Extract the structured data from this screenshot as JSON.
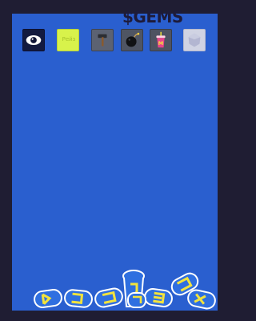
{
  "title": "$GEMS",
  "toolbar": {
    "tools": [
      {
        "name": "eye-icon",
        "color": "#131a3f"
      },
      {
        "name": "brush-icon",
        "color": "#d8f24b",
        "label": "Рейз"
      },
      {
        "name": "hammer-icon",
        "color": "#5c6272"
      },
      {
        "name": "bomb-icon",
        "color": "#4f5563"
      },
      {
        "name": "cup-icon",
        "color": "#4e5361"
      },
      {
        "name": "gem-icon",
        "color": "#d0d3e3"
      }
    ]
  },
  "playfield": {
    "color": "#2a5fcf",
    "border_color": "#1f1d33"
  },
  "pile": {
    "item": "cup-piece",
    "count": 8,
    "colors": {
      "body": "#2f6fe0",
      "accent": "#f2e33c",
      "outline": "#ffffff"
    }
  }
}
